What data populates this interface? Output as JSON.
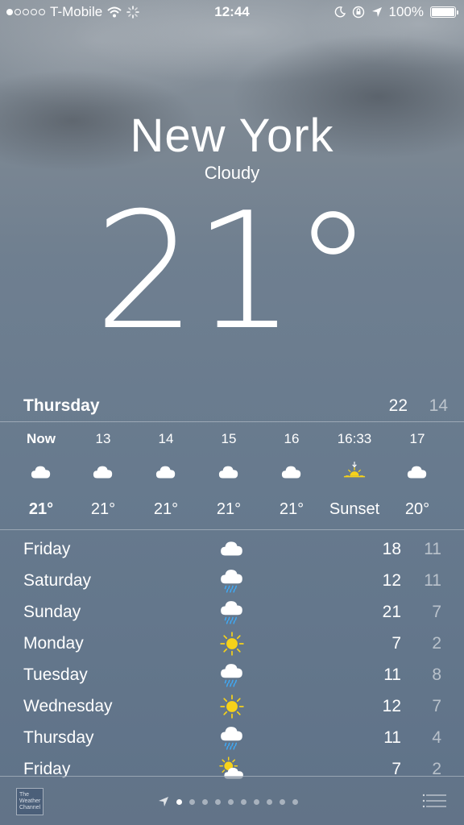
{
  "status_bar": {
    "carrier": "T-Mobile",
    "time": "12:44",
    "battery": "100%"
  },
  "location": {
    "city": "New York",
    "condition": "Cloudy",
    "temperature": "21°"
  },
  "today": {
    "day": "Thursday",
    "high": "22",
    "low": "14"
  },
  "hourly": [
    {
      "time": "Now",
      "icon": "cloud-icon",
      "temp": "21°"
    },
    {
      "time": "13",
      "icon": "cloud-icon",
      "temp": "21°"
    },
    {
      "time": "14",
      "icon": "cloud-icon",
      "temp": "21°"
    },
    {
      "time": "15",
      "icon": "cloud-icon",
      "temp": "21°"
    },
    {
      "time": "16",
      "icon": "cloud-icon",
      "temp": "21°"
    },
    {
      "time": "16:33",
      "icon": "sunset-icon",
      "temp": "Sunset"
    },
    {
      "time": "17",
      "icon": "cloud-icon",
      "temp": "20°"
    }
  ],
  "daily": [
    {
      "day": "Friday",
      "icon": "cloud-icon",
      "high": "18",
      "low": "11"
    },
    {
      "day": "Saturday",
      "icon": "rain-icon",
      "high": "12",
      "low": "11"
    },
    {
      "day": "Sunday",
      "icon": "rain-icon",
      "high": "21",
      "low": "7"
    },
    {
      "day": "Monday",
      "icon": "sun-icon",
      "high": "7",
      "low": "2"
    },
    {
      "day": "Tuesday",
      "icon": "rain-icon",
      "high": "11",
      "low": "8"
    },
    {
      "day": "Wednesday",
      "icon": "sun-icon",
      "high": "12",
      "low": "7"
    },
    {
      "day": "Thursday",
      "icon": "rain-icon",
      "high": "11",
      "low": "4"
    },
    {
      "day": "Friday",
      "icon": "partly-cloudy-icon",
      "high": "7",
      "low": "2"
    }
  ],
  "footer": {
    "provider_logo_text": "The Weather Channel",
    "page_count": 10,
    "active_page": 0
  },
  "colors": {
    "sun": "#f6d21a",
    "rain": "#3fa9f5",
    "cloud": "#ffffff"
  }
}
